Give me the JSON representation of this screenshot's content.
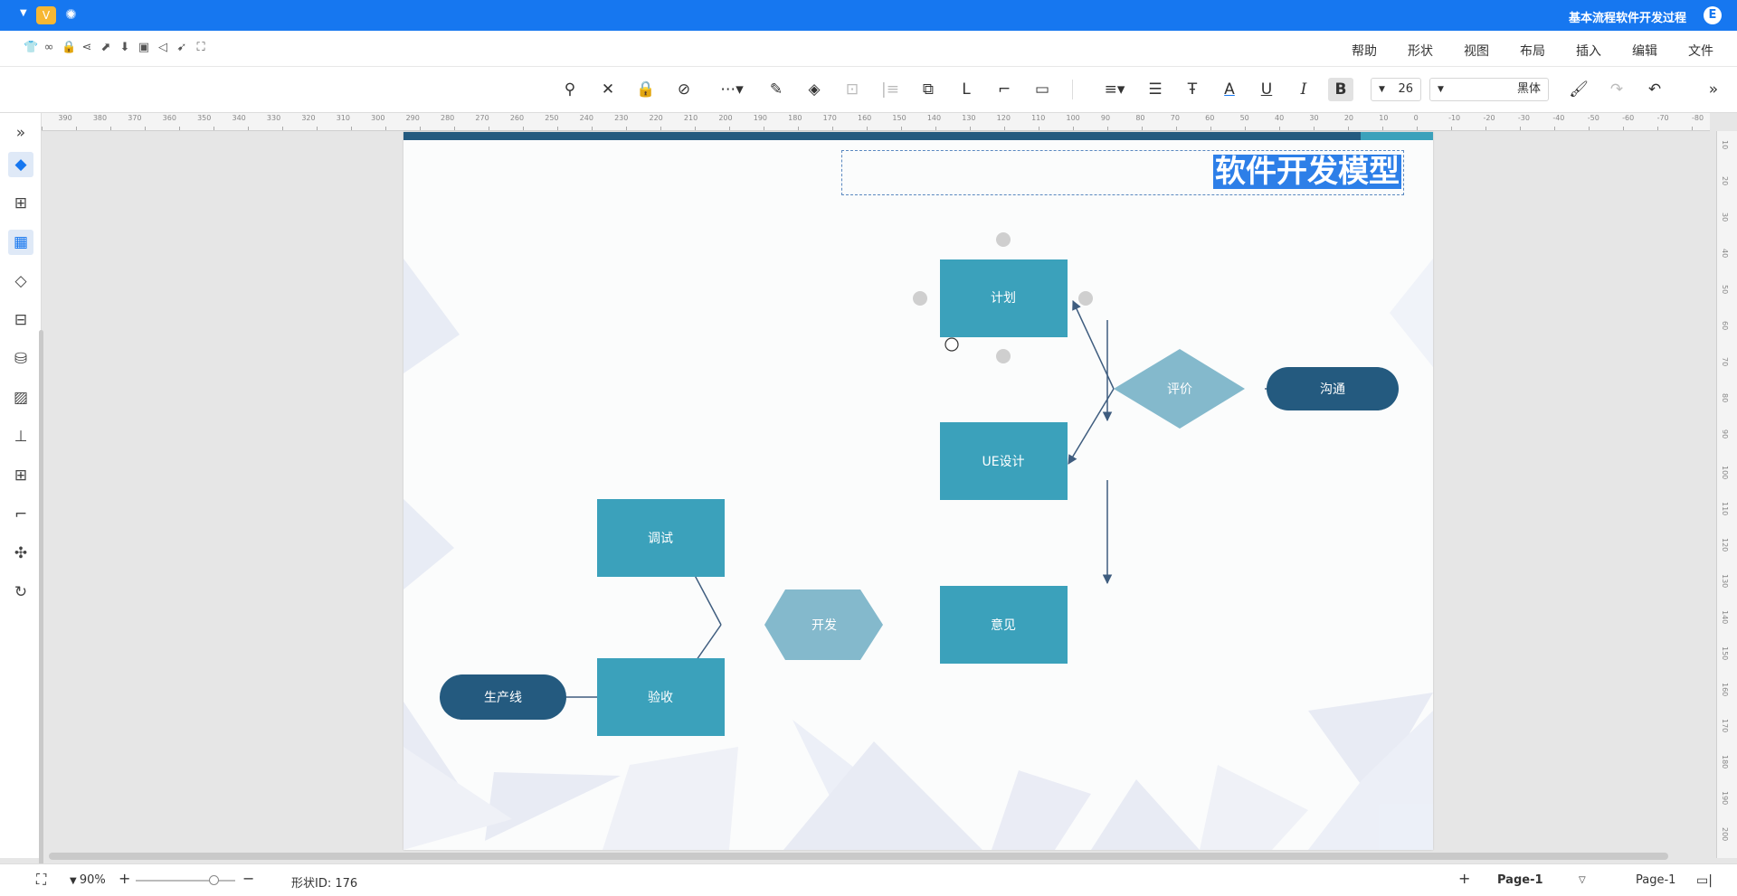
{
  "app": {
    "title": "基本流程软件开发过程",
    "logo": "E"
  },
  "menu": [
    "文件",
    "编辑",
    "插入",
    "布局",
    "视图",
    "形状",
    "帮助"
  ],
  "toolbar": {
    "font_name": "黑体",
    "font_size": "26"
  },
  "canvas": {
    "title": "软件开发模型",
    "nodes": {
      "plan": "计划",
      "ue": "UE设计",
      "opinion": "意见",
      "debug": "调试",
      "develop": "开发",
      "accept": "验收",
      "production": "生产线",
      "evaluate": "评价",
      "communicate": "沟通"
    }
  },
  "status": {
    "page_tab": "Page-1",
    "page_select": "Page-1",
    "shape_id": "形状ID: 176",
    "zoom": "90%"
  },
  "ruler": {
    "top": [
      "-80",
      "-70",
      "-60",
      "-50",
      "-40",
      "-30",
      "-20",
      "-10",
      "0",
      "10",
      "20",
      "30",
      "40",
      "50",
      "60",
      "70",
      "80",
      "90",
      "100",
      "110",
      "120",
      "130",
      "140",
      "150",
      "160",
      "170",
      "180",
      "190",
      "200",
      "210",
      "220",
      "230",
      "240",
      "250",
      "260",
      "270",
      "280",
      "290",
      "300",
      "310",
      "320",
      "330",
      "340",
      "350",
      "360",
      "370",
      "380",
      "390"
    ],
    "left": [
      "10",
      "20",
      "30",
      "40",
      "50",
      "60",
      "70",
      "80",
      "90",
      "100",
      "110",
      "120",
      "130",
      "140",
      "150",
      "160",
      "170",
      "180",
      "190",
      "200"
    ]
  },
  "colors": {
    "accent": "#1677f0",
    "box": "#3ba1bb",
    "dark": "#245a7f",
    "diamond": "#84b9cc",
    "edge": "#3f5d7f"
  },
  "icons": {
    "sidebar": [
      "expand-icon",
      "format-painter-icon",
      "page-icon",
      "grid-icon",
      "layers-icon",
      "presentation-icon",
      "database-icon",
      "image-icon",
      "org-chart-icon",
      "table-icon",
      "timeline-icon",
      "mindmap-icon",
      "history-icon"
    ]
  }
}
